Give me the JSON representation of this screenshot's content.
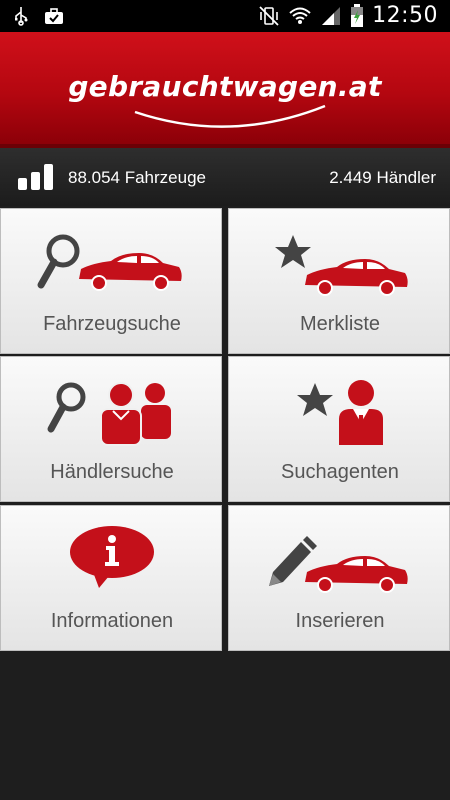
{
  "status_bar": {
    "time": "12:50",
    "icons": [
      "usb-icon",
      "briefcase-icon",
      "vibrate-off-icon",
      "wifi-icon",
      "signal-icon",
      "battery-charging-icon"
    ]
  },
  "header": {
    "logo_text": "gebrauchtwagen.at"
  },
  "stats": {
    "vehicles": "88.054 Fahrzeuge",
    "dealers": "2.449 Händler"
  },
  "colors": {
    "brand_red": "#c4101a",
    "icon_dark": "#444444"
  },
  "menu": [
    {
      "label": "Fahrzeugsuche",
      "icon": "magnifier-car-icon"
    },
    {
      "label": "Merkliste",
      "icon": "star-car-icon"
    },
    {
      "label": "Händlersuche",
      "icon": "magnifier-people-icon"
    },
    {
      "label": "Suchagenten",
      "icon": "star-agent-icon"
    },
    {
      "label": "Informationen",
      "icon": "info-bubble-icon"
    },
    {
      "label": "Inserieren",
      "icon": "pencil-car-icon"
    }
  ]
}
